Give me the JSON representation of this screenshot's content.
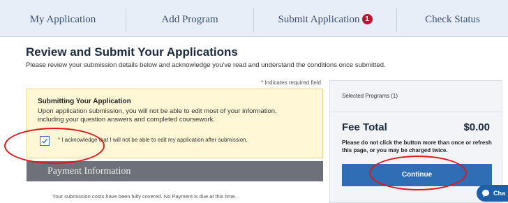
{
  "nav": {
    "tabs": [
      {
        "label": "My Application"
      },
      {
        "label": "Add Program"
      },
      {
        "label": "Submit Application",
        "badge": "1"
      },
      {
        "label": "Check Status"
      }
    ]
  },
  "main": {
    "title": "Review and Submit Your Applications",
    "subtitle": "Please review your submission details below and acknowledge you've read and understand the conditions once submitted.",
    "required_note": "Indicates required field",
    "required_star": "*"
  },
  "notice": {
    "title": "Submitting Your Application",
    "text": "Upon application submission, you will not be able to edit most of your information, including your question answers and completed coursework.",
    "ack_label": "I acknowledge that I will not be able to edit my application after submission.",
    "checked": true
  },
  "payment": {
    "heading": "Payment Information",
    "text": "Your submission costs have been fully covered. No Payment is due at this time."
  },
  "summary": {
    "selected_programs": "Selected Programs (1)",
    "fee_label": "Fee Total",
    "fee_amount": "$0.00",
    "warning": "Please do not click the button more than once or refresh this page, or you may be charged twice.",
    "continue_label": "Continue"
  },
  "chat": {
    "label": "Cha"
  },
  "colors": {
    "accent": "#2f6db5",
    "badge": "#c4122e",
    "annotation": "#e01818",
    "notice_bg": "#fff7d6"
  }
}
